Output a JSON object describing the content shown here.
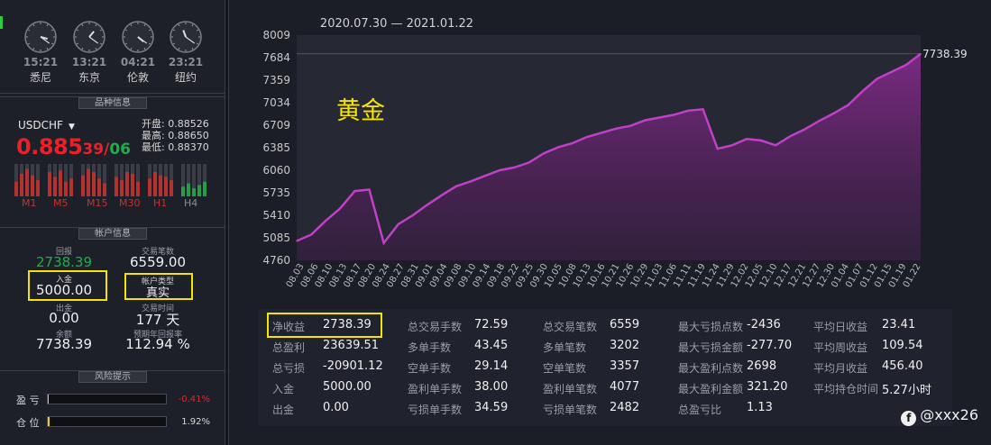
{
  "clocks": [
    {
      "time": "15:21",
      "city": "悉尼",
      "angle_h": 105,
      "angle_m": 126
    },
    {
      "time": "13:21",
      "city": "东京",
      "angle_h": 40,
      "angle_m": 126
    },
    {
      "time": "04:21",
      "city": "伦敦",
      "angle_h": 130,
      "angle_m": 126
    },
    {
      "time": "23:21",
      "city": "纽约",
      "angle_h": 340,
      "angle_m": 126
    }
  ],
  "instrument": {
    "section_title": "品种信息",
    "symbol": "USDCHF",
    "price_big": "0.885",
    "price_small1": "39",
    "price_slash": "/",
    "price_small2": "06",
    "open": "开盘: 0.88526",
    "high": "最高: 0.88650",
    "low": "最低: 0.88370",
    "timeframes": [
      "M1",
      "M5",
      "M15",
      "M30",
      "H1",
      "H4"
    ]
  },
  "account": {
    "section_title": "帐户信息",
    "return_label": "回报",
    "return_value": "2738.39",
    "trades_label": "交易笔数",
    "trades_value": "6559.00",
    "deposit_label": "入金",
    "deposit_value": "5000.00",
    "type_label": "帐户类型",
    "type_value": "真实",
    "withdraw_label": "出金",
    "withdraw_value": "0.00",
    "duration_label": "交易时间",
    "duration_value": "177 天",
    "balance_label": "余额",
    "balance_value": "7738.39",
    "annual_label": "预期年回报率",
    "annual_value": "112.94 %"
  },
  "risk": {
    "section_title": "风险提示",
    "pnl_label": "盈 亏",
    "pnl_pct": "-0.41%",
    "pnl_fill": 0.01,
    "pos_label": "仓 位",
    "pos_pct": "1.92%",
    "pos_fill": 0.019
  },
  "colors": {
    "line": "#c040c8",
    "up": "#1fae4a",
    "down": "#e8212a",
    "highlight": "#f5e400",
    "gold_label": "#f5e400"
  },
  "chart_data": {
    "type": "area",
    "title": "2020.07.30 — 2021.01.22",
    "annotation": "黄金",
    "last_value_label": "7738.39",
    "ylim": [
      4760,
      8009
    ],
    "yticks": [
      "8009",
      "7684",
      "7359",
      "7034",
      "6709",
      "6385",
      "6060",
      "5735",
      "5410",
      "5085",
      "4760"
    ],
    "xticks": [
      "08.03",
      "08.06",
      "08.10",
      "08.13",
      "08.17",
      "08.20",
      "08.24",
      "08.27",
      "08.31",
      "09.01",
      "09.04",
      "09.08",
      "09.10",
      "09.14",
      "09.18",
      "09.22",
      "09.25",
      "09.30",
      "10.05",
      "10.08",
      "10.13",
      "10.16",
      "10.21",
      "10.26",
      "10.29",
      "11.03",
      "11.06",
      "11.11",
      "11.19",
      "11.24",
      "11.29",
      "12.02",
      "12.05",
      "12.10",
      "12.17",
      "12.21",
      "12.27",
      "12.30",
      "01.04",
      "01.07",
      "01.12",
      "01.15",
      "01.19",
      "01.22"
    ],
    "x": [
      0,
      1,
      2,
      3,
      4,
      5,
      6,
      7,
      8,
      9,
      10,
      11,
      12,
      13,
      14,
      15,
      16,
      17,
      18,
      19,
      20,
      21,
      22,
      23,
      24,
      25,
      26,
      27,
      28,
      29,
      30,
      31,
      32,
      33,
      34,
      35,
      36,
      37,
      38,
      39,
      40,
      41,
      42,
      43
    ],
    "values": [
      5040,
      5130,
      5330,
      5510,
      5760,
      5780,
      5010,
      5280,
      5410,
      5560,
      5700,
      5830,
      5900,
      5980,
      6060,
      6100,
      6170,
      6300,
      6390,
      6450,
      6540,
      6600,
      6660,
      6700,
      6780,
      6820,
      6860,
      6920,
      6940,
      6370,
      6420,
      6510,
      6490,
      6420,
      6550,
      6650,
      6770,
      6880,
      7000,
      7200,
      7380,
      7480,
      7580,
      7738.39
    ]
  },
  "stats": {
    "net_profit_label": "净收益",
    "net_profit": "2738.39",
    "gross_profit_label": "总盈利",
    "gross_profit": "23639.51",
    "gross_loss_label": "总亏损",
    "gross_loss": "-20901.12",
    "deposit_label": "入金",
    "deposit": "5000.00",
    "withdraw_label": "出金",
    "withdraw": "0.00",
    "total_lots_label": "总交易手数",
    "total_lots": "72.59",
    "long_lots_label": "多单手数",
    "long_lots": "43.45",
    "short_lots_label": "空单手数",
    "short_lots": "29.14",
    "win_lots_label": "盈利单手数",
    "win_lots": "38.00",
    "loss_lots_label": "亏损单手数",
    "loss_lots": "34.59",
    "total_trades_label": "总交易笔数",
    "total_trades": "6559",
    "long_trades_label": "多单笔数",
    "long_trades": "3202",
    "short_trades_label": "空单笔数",
    "short_trades": "3357",
    "win_trades_label": "盈利单笔数",
    "win_trades": "4077",
    "loss_trades_label": "亏损单笔数",
    "loss_trades": "2482",
    "max_loss_pts_label": "最大亏损点数",
    "max_loss_pts": "-2436",
    "max_loss_amt_label": "最大亏损金额",
    "max_loss_amt": "-277.70",
    "max_win_pts_label": "最大盈利点数",
    "max_win_pts": "2698",
    "max_win_amt_label": "最大盈利金额",
    "max_win_amt": "321.20",
    "pl_ratio_label": "总盈亏比",
    "pl_ratio": "1.13",
    "avg_daily_label": "平均日收益",
    "avg_daily": "23.41",
    "avg_weekly_label": "平均周收益",
    "avg_weekly": "109.54",
    "avg_monthly_label": "平均月收益",
    "avg_monthly": "456.40",
    "avg_hold_label": "平均持仓时间",
    "avg_hold": "5.27小时"
  },
  "watermark": {
    "logo": "f",
    "text": "@xxx26"
  }
}
